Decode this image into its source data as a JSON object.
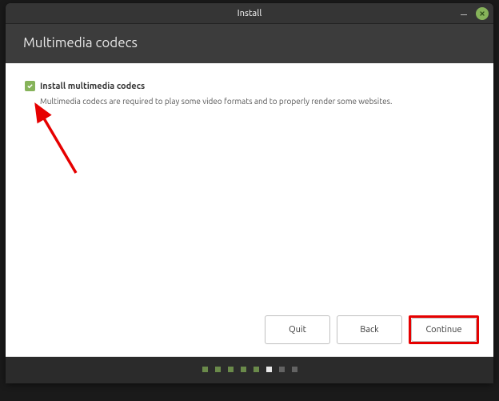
{
  "window": {
    "title": "Install"
  },
  "header": {
    "title": "Multimedia codecs"
  },
  "content": {
    "checkbox_label": "Install multimedia codecs",
    "checkbox_checked": true,
    "description": "Multimedia codecs are required to play some video formats and to properly render some websites."
  },
  "buttons": {
    "quit": "Quit",
    "back": "Back",
    "continue": "Continue"
  },
  "pager": {
    "total": 8,
    "current": 5
  },
  "colors": {
    "accent": "#86b35a",
    "annotation": "#e60000"
  }
}
